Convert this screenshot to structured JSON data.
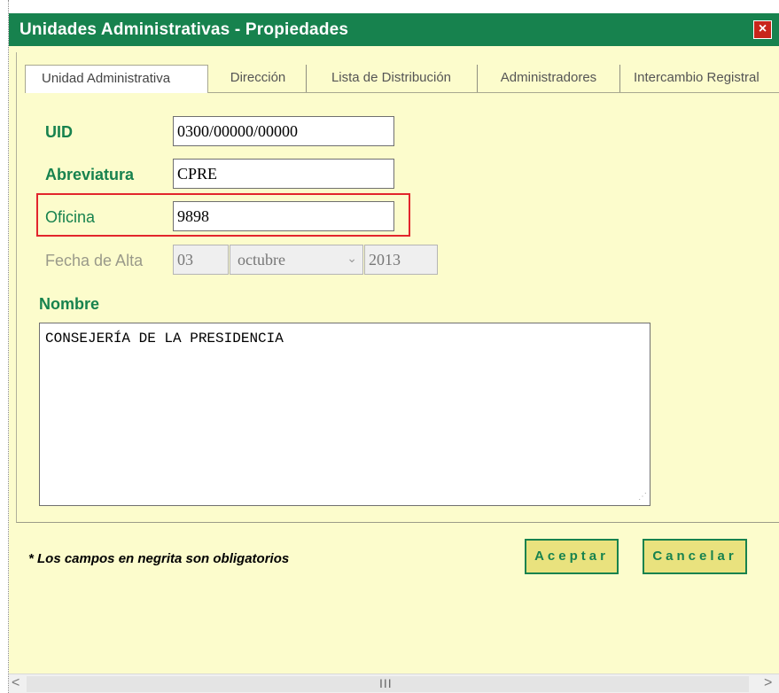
{
  "window": {
    "title": "Unidades Administrativas - Propiedades",
    "close_glyph": "×"
  },
  "tabs": [
    {
      "label": "Unidad Administrativa",
      "active": true
    },
    {
      "label": "Dirección",
      "active": false
    },
    {
      "label": "Lista de Distribución",
      "active": false
    },
    {
      "label": "Administradores",
      "active": false
    },
    {
      "label": "Intercambio Registral",
      "active": false
    }
  ],
  "form": {
    "uid": {
      "label": "UID",
      "value": "0300/00000/00000"
    },
    "abreviatura": {
      "label": "Abreviatura",
      "value": "CPRE"
    },
    "oficina": {
      "label": "Oficina",
      "value": "9898"
    },
    "fecha_alta": {
      "label": "Fecha de Alta",
      "day": "03",
      "month": "octubre",
      "year": "2013"
    },
    "nombre": {
      "label": "Nombre",
      "value": "CONSEJERÍA DE LA PRESIDENCIA"
    }
  },
  "footer": {
    "note": "* Los campos en negrita son obligatorios",
    "accept_label": "Aceptar",
    "cancel_label": "Cancelar"
  },
  "scrollbar": {
    "left_arrow": "<",
    "right_arrow": ">",
    "grip": "III"
  },
  "colors": {
    "titlebar": "#17824e",
    "background": "#fcfccc",
    "highlight": "#e2252c",
    "button": "#e9e27e"
  }
}
